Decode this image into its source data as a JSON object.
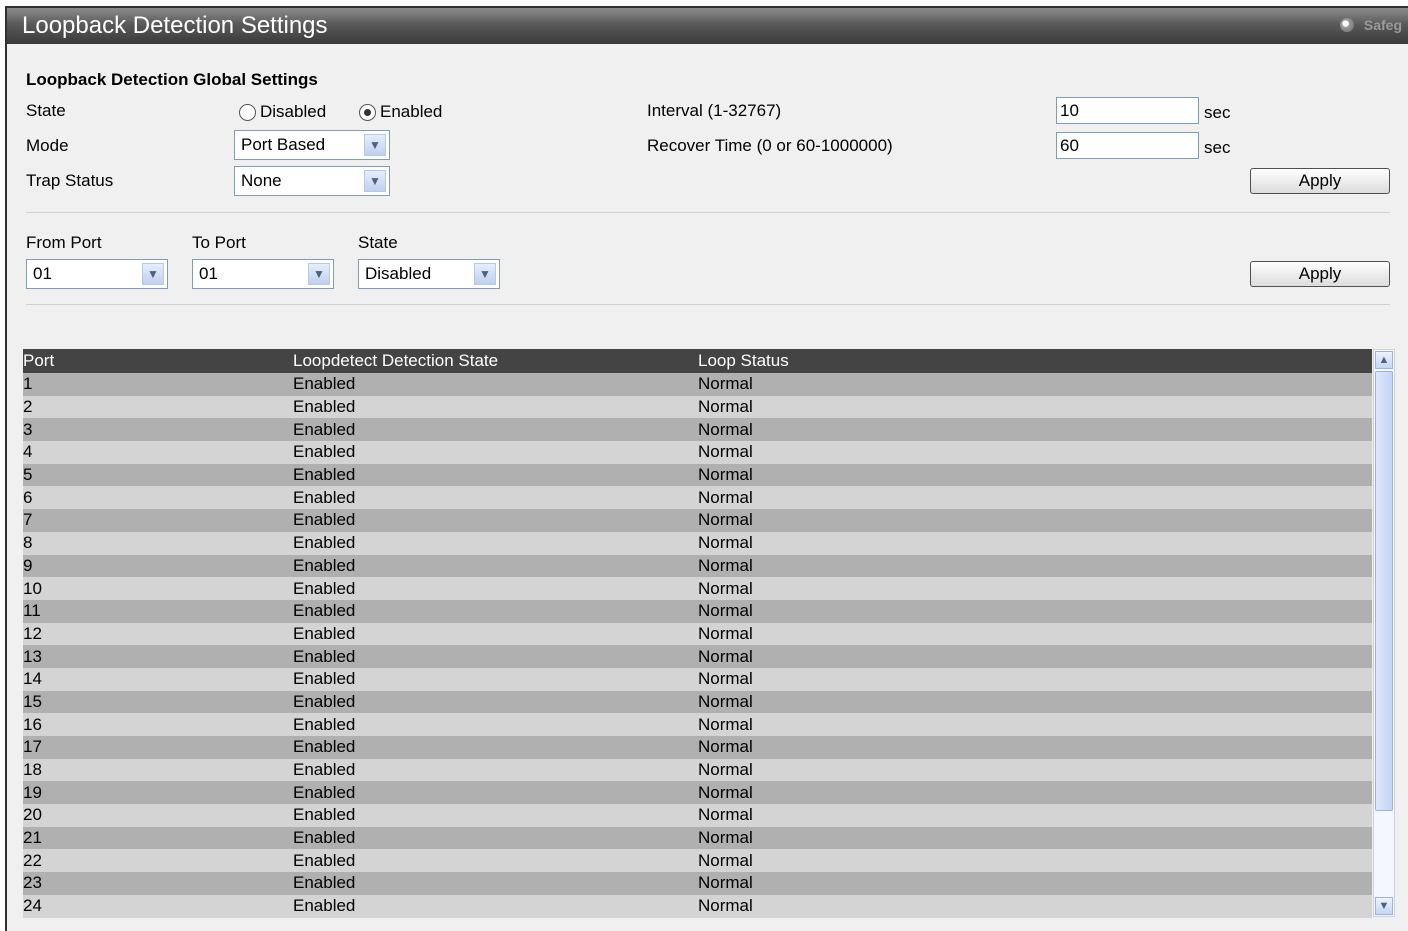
{
  "window": {
    "title": "Loopback Detection Settings",
    "safeguard_label": "Safeg"
  },
  "global": {
    "section_title": "Loopback Detection Global Settings",
    "state_label": "State",
    "state_options": [
      "Disabled",
      "Enabled"
    ],
    "state_selected": "Enabled",
    "mode_label": "Mode",
    "mode_value": "Port Based",
    "trap_label": "Trap Status",
    "trap_value": "None",
    "interval_label": "Interval (1-32767)",
    "interval_value": "10",
    "interval_unit": "sec",
    "recover_label": "Recover Time (0 or 60-1000000)",
    "recover_value": "60",
    "recover_unit": "sec",
    "apply_label": "Apply"
  },
  "port_settings": {
    "from_label": "From Port",
    "from_value": "01",
    "to_label": "To Port",
    "to_value": "01",
    "state_label": "State",
    "state_value": "Disabled",
    "apply_label": "Apply"
  },
  "table": {
    "headers": [
      "Port",
      "Loopdetect Detection State",
      "Loop Status"
    ],
    "rows": [
      [
        "1",
        "Enabled",
        "Normal"
      ],
      [
        "2",
        "Enabled",
        "Normal"
      ],
      [
        "3",
        "Enabled",
        "Normal"
      ],
      [
        "4",
        "Enabled",
        "Normal"
      ],
      [
        "5",
        "Enabled",
        "Normal"
      ],
      [
        "6",
        "Enabled",
        "Normal"
      ],
      [
        "7",
        "Enabled",
        "Normal"
      ],
      [
        "8",
        "Enabled",
        "Normal"
      ],
      [
        "9",
        "Enabled",
        "Normal"
      ],
      [
        "10",
        "Enabled",
        "Normal"
      ],
      [
        "11",
        "Enabled",
        "Normal"
      ],
      [
        "12",
        "Enabled",
        "Normal"
      ],
      [
        "13",
        "Enabled",
        "Normal"
      ],
      [
        "14",
        "Enabled",
        "Normal"
      ],
      [
        "15",
        "Enabled",
        "Normal"
      ],
      [
        "16",
        "Enabled",
        "Normal"
      ],
      [
        "17",
        "Enabled",
        "Normal"
      ],
      [
        "18",
        "Enabled",
        "Normal"
      ],
      [
        "19",
        "Enabled",
        "Normal"
      ],
      [
        "20",
        "Enabled",
        "Normal"
      ],
      [
        "21",
        "Enabled",
        "Normal"
      ],
      [
        "22",
        "Enabled",
        "Normal"
      ],
      [
        "23",
        "Enabled",
        "Normal"
      ],
      [
        "24",
        "Enabled",
        "Normal"
      ]
    ]
  },
  "icons": {
    "safeguard": "safeguard-icon",
    "dropdown": "chevron-down-icon",
    "scroll_up": "chevron-up-icon",
    "scroll_down": "chevron-down-icon"
  },
  "colors": {
    "header_bg": "#444444",
    "row_odd": "#b0b0b0",
    "row_even": "#d4d4d4",
    "panel_bg": "#f0f0f0"
  }
}
